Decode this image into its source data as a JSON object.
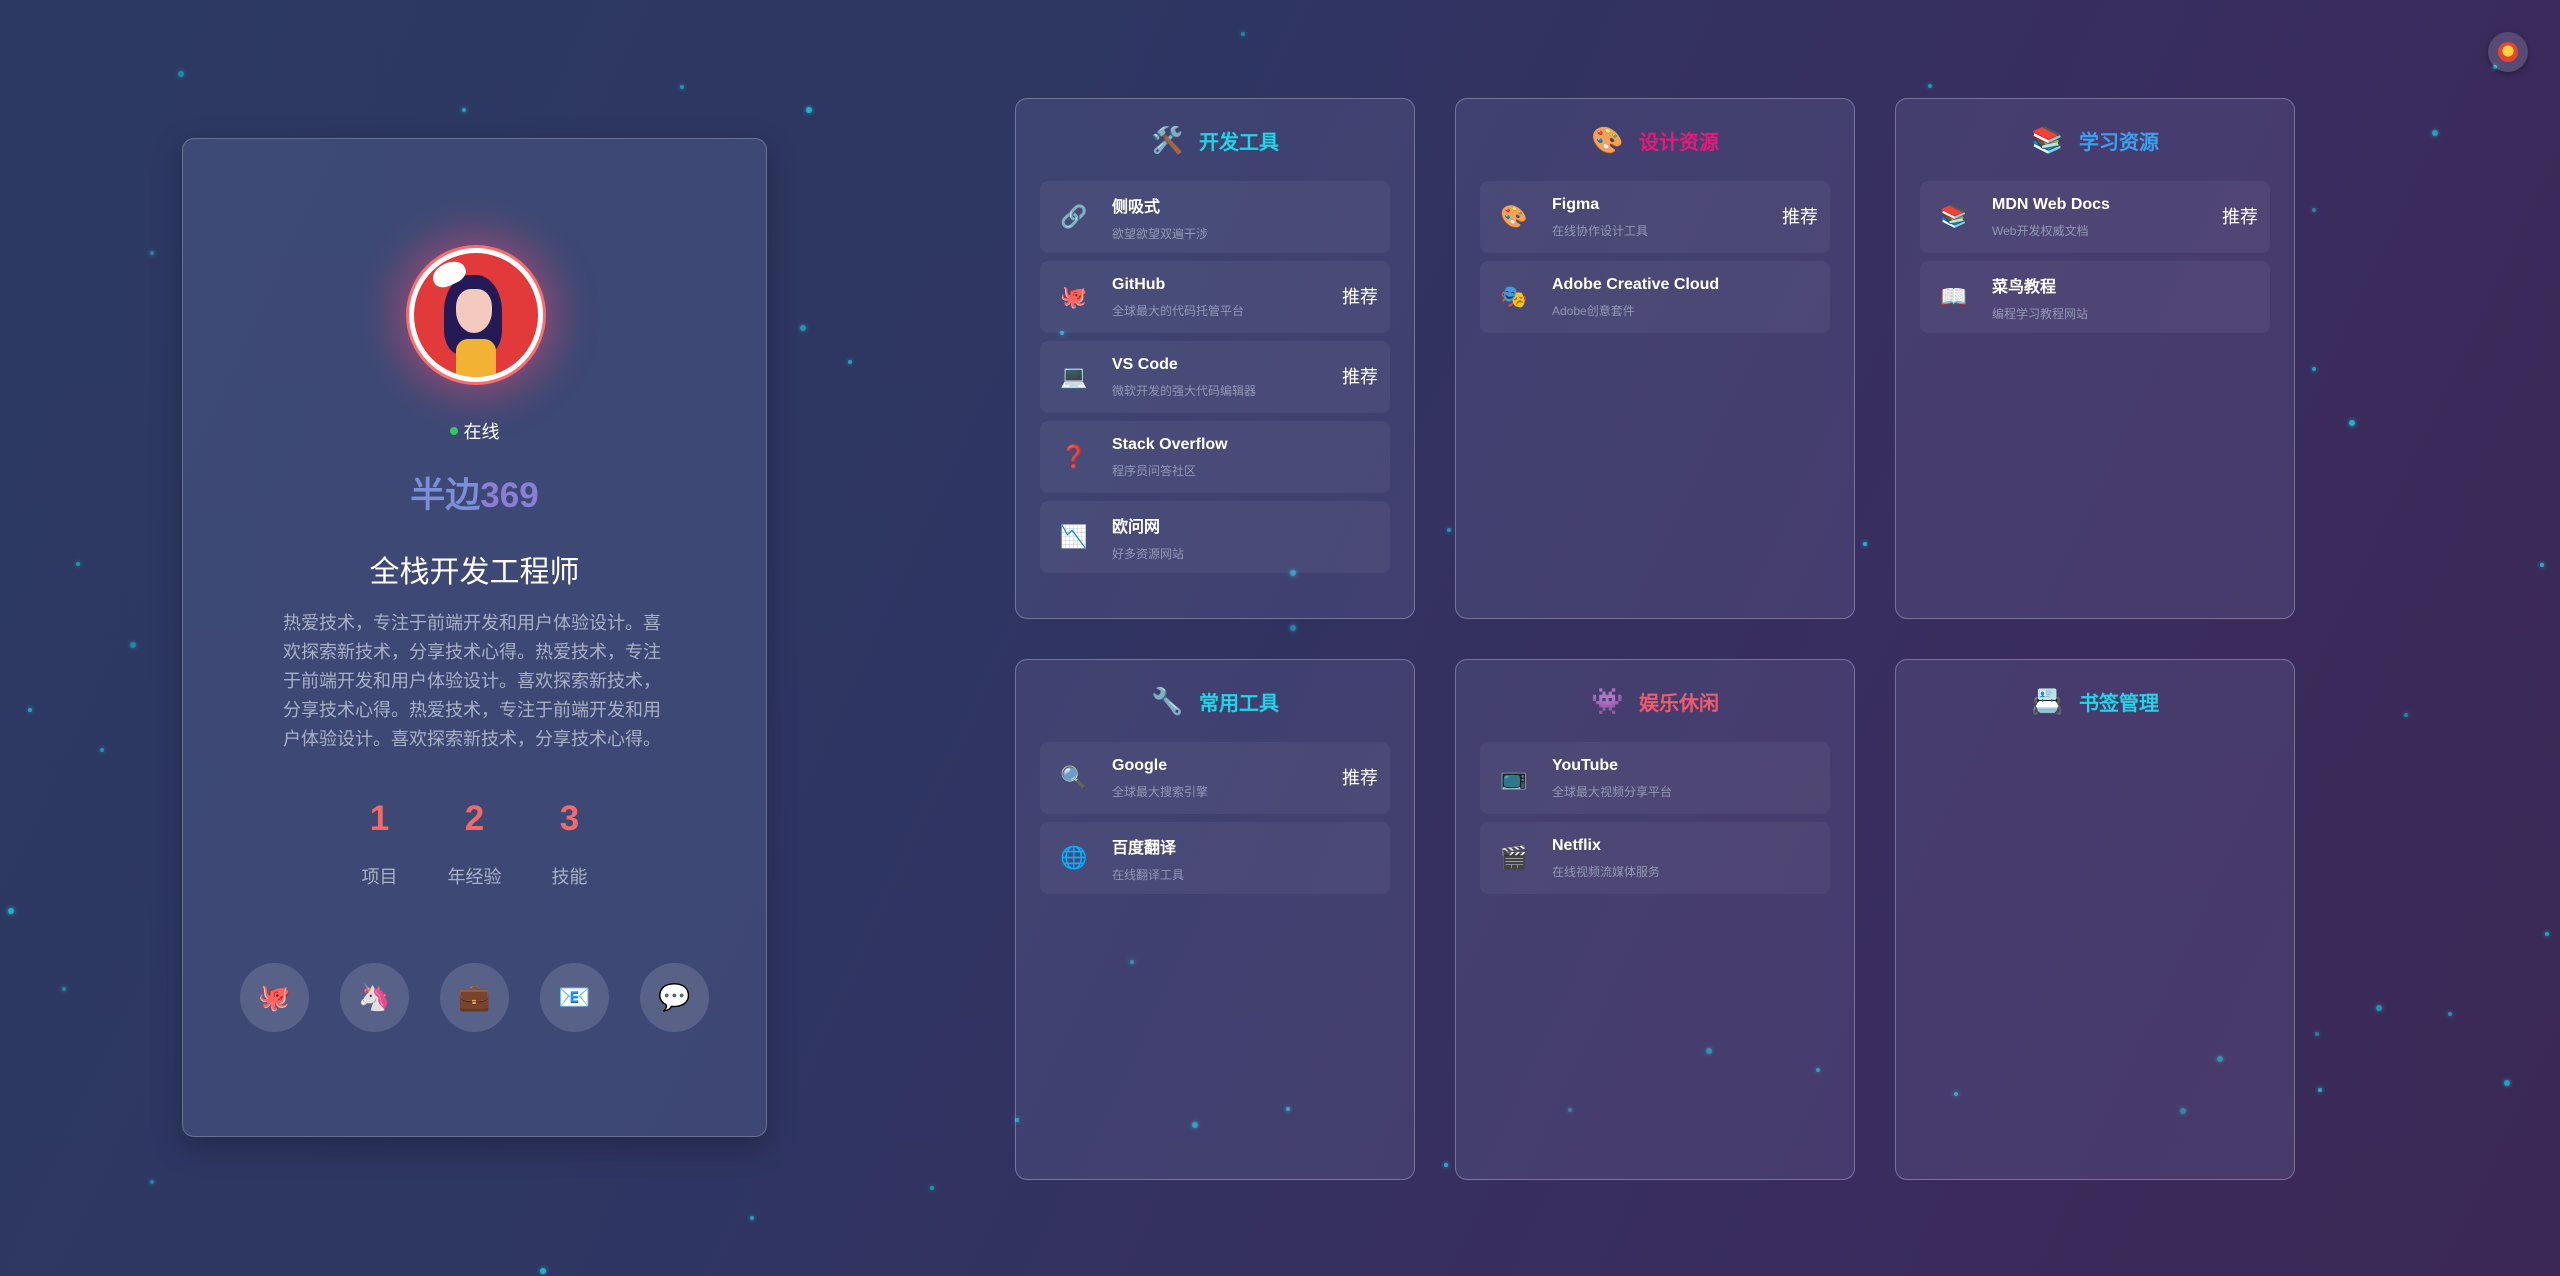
{
  "profile": {
    "status": "在线",
    "name_prefix": "半边",
    "name_suffix": "369",
    "role": "全栈开发工程师",
    "bio": "热爱技术，专注于前端开发和用户体验设计。喜欢探索新技术，分享技术心得。热爱技术，专注于前端开发和用户体验设计。喜欢探索新技术，分享技术心得。热爱技术，专注于前端开发和用户体验设计。喜欢探索新技术，分享技术心得。",
    "stats": [
      {
        "value": "1",
        "label": "项目"
      },
      {
        "value": "2",
        "label": "年经验"
      },
      {
        "value": "3",
        "label": "技能"
      }
    ],
    "socials": [
      {
        "icon": "🐙",
        "name": "github-icon"
      },
      {
        "icon": "🦄",
        "name": "unicorn-icon"
      },
      {
        "icon": "💼",
        "name": "briefcase-icon"
      },
      {
        "icon": "📧",
        "name": "email-icon"
      },
      {
        "icon": "💬",
        "name": "chat-icon"
      }
    ]
  },
  "categories": [
    {
      "title": "开发工具",
      "icon": "🛠️",
      "color": "#1ed6e8",
      "items": [
        {
          "icon": "🔗",
          "name": "侧吸式",
          "desc": "欲望欲望双遍干涉",
          "rec": ""
        },
        {
          "icon": "🐙",
          "name": "GitHub",
          "desc": "全球最大的代码托管平台",
          "rec": "推荐"
        },
        {
          "icon": "💻",
          "name": "VS Code",
          "desc": "微软开发的强大代码编辑器",
          "rec": "推荐"
        },
        {
          "icon": "❓",
          "name": "Stack Overflow",
          "desc": "程序员问答社区",
          "rec": ""
        },
        {
          "icon": "📉",
          "name": "欧问网",
          "desc": "好多资源网站",
          "rec": ""
        }
      ]
    },
    {
      "title": "设计资源",
      "icon": "🎨",
      "color": "#e8187c",
      "items": [
        {
          "icon": "🎨",
          "name": "Figma",
          "desc": "在线协作设计工具",
          "rec": "推荐"
        },
        {
          "icon": "🎭",
          "name": "Adobe Creative Cloud",
          "desc": "Adobe创意套件",
          "rec": ""
        }
      ]
    },
    {
      "title": "学习资源",
      "icon": "📚",
      "color": "#3aa0f0",
      "items": [
        {
          "icon": "📚",
          "name": "MDN Web Docs",
          "desc": "Web开发权威文档",
          "rec": "推荐"
        },
        {
          "icon": "📖",
          "name": "菜鸟教程",
          "desc": "编程学习教程网站",
          "rec": ""
        }
      ]
    },
    {
      "title": "常用工具",
      "icon": "🔧",
      "color": "#1ed6e8",
      "items": [
        {
          "icon": "🔍",
          "name": "Google",
          "desc": "全球最大搜索引擎",
          "rec": "推荐"
        },
        {
          "icon": "🌐",
          "name": "百度翻译",
          "desc": "在线翻译工具",
          "rec": ""
        }
      ]
    },
    {
      "title": "娱乐休闲",
      "icon": "👾",
      "color": "#f05a6a",
      "items": [
        {
          "icon": "📺",
          "name": "YouTube",
          "desc": "全球最大视频分享平台",
          "rec": ""
        },
        {
          "icon": "🎬",
          "name": "Netflix",
          "desc": "在线视频流媒体服务",
          "rec": ""
        }
      ]
    },
    {
      "title": "书签管理",
      "icon": "📇",
      "color": "#1ed6e8",
      "items": []
    }
  ]
}
